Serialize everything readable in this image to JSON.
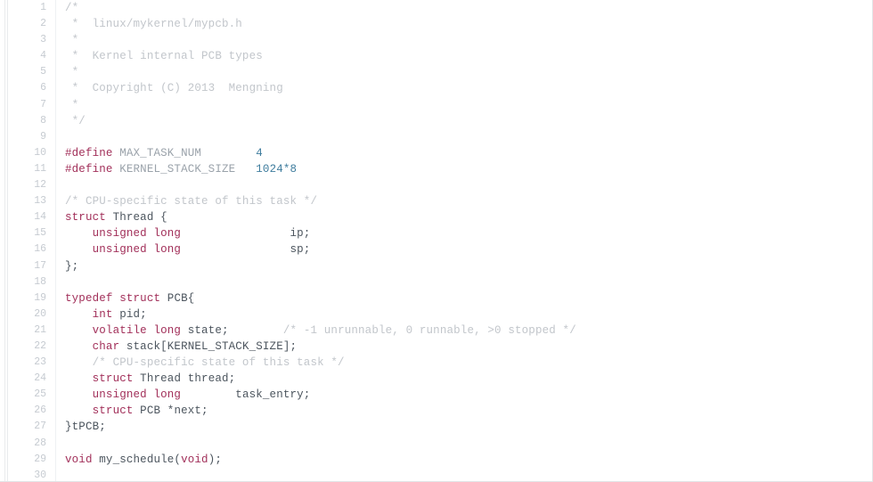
{
  "editor": {
    "title": "mypcb.h",
    "language": "C",
    "first_line": 1,
    "last_line": 30,
    "total_lines": 30,
    "colors": {
      "background": "#ffffff",
      "text": "#4c555e",
      "keyword": "#a2305a",
      "comment": "#c2c6cb",
      "number": "#3f7d9e",
      "macro_name": "#9aa2aa",
      "line_number": "#c6cbd1",
      "gutter_divider": "#eff1f3"
    }
  },
  "lines": [
    {
      "n": "1",
      "tokens": [
        {
          "t": "/*",
          "c": "comment"
        }
      ]
    },
    {
      "n": "2",
      "tokens": [
        {
          "t": " *  linux/mykernel/mypcb.h",
          "c": "comment"
        }
      ]
    },
    {
      "n": "3",
      "tokens": [
        {
          "t": " *",
          "c": "comment"
        }
      ]
    },
    {
      "n": "4",
      "tokens": [
        {
          "t": " *  Kernel internal PCB types",
          "c": "comment"
        }
      ]
    },
    {
      "n": "5",
      "tokens": [
        {
          "t": " *",
          "c": "comment"
        }
      ]
    },
    {
      "n": "6",
      "tokens": [
        {
          "t": " *  Copyright (C) 2013  Mengning",
          "c": "comment"
        }
      ]
    },
    {
      "n": "7",
      "tokens": [
        {
          "t": " *",
          "c": "comment"
        }
      ]
    },
    {
      "n": "8",
      "tokens": [
        {
          "t": " */",
          "c": "comment"
        }
      ]
    },
    {
      "n": "9",
      "tokens": [
        {
          "t": "",
          "c": "plain"
        }
      ]
    },
    {
      "n": "10",
      "tokens": [
        {
          "t": "#define",
          "c": "keyword"
        },
        {
          "t": " ",
          "c": "plain"
        },
        {
          "t": "MAX_TASK_NUM",
          "c": "macro"
        },
        {
          "t": "        ",
          "c": "plain"
        },
        {
          "t": "4",
          "c": "number"
        }
      ]
    },
    {
      "n": "11",
      "tokens": [
        {
          "t": "#define",
          "c": "keyword"
        },
        {
          "t": " ",
          "c": "plain"
        },
        {
          "t": "KERNEL_STACK_SIZE",
          "c": "macro"
        },
        {
          "t": "   ",
          "c": "plain"
        },
        {
          "t": "1024*8",
          "c": "number"
        }
      ]
    },
    {
      "n": "12",
      "tokens": [
        {
          "t": "",
          "c": "plain"
        }
      ]
    },
    {
      "n": "13",
      "tokens": [
        {
          "t": "/* CPU-specific state of this task */",
          "c": "comment"
        }
      ]
    },
    {
      "n": "14",
      "tokens": [
        {
          "t": "struct",
          "c": "keyword"
        },
        {
          "t": " Thread {",
          "c": "plain"
        }
      ]
    },
    {
      "n": "15",
      "tokens": [
        {
          "t": "    ",
          "c": "plain"
        },
        {
          "t": "unsigned long",
          "c": "keyword"
        },
        {
          "t": "                ",
          "c": "plain"
        },
        {
          "t": "ip;",
          "c": "plain"
        }
      ]
    },
    {
      "n": "16",
      "tokens": [
        {
          "t": "    ",
          "c": "plain"
        },
        {
          "t": "unsigned long",
          "c": "keyword"
        },
        {
          "t": "                ",
          "c": "plain"
        },
        {
          "t": "sp;",
          "c": "plain"
        }
      ]
    },
    {
      "n": "17",
      "tokens": [
        {
          "t": "};",
          "c": "plain"
        }
      ]
    },
    {
      "n": "18",
      "tokens": [
        {
          "t": "",
          "c": "plain"
        }
      ]
    },
    {
      "n": "19",
      "tokens": [
        {
          "t": "typedef",
          "c": "keyword"
        },
        {
          "t": " ",
          "c": "plain"
        },
        {
          "t": "struct",
          "c": "keyword"
        },
        {
          "t": " PCB{",
          "c": "plain"
        }
      ]
    },
    {
      "n": "20",
      "tokens": [
        {
          "t": "    ",
          "c": "plain"
        },
        {
          "t": "int",
          "c": "keyword"
        },
        {
          "t": " pid;",
          "c": "plain"
        }
      ]
    },
    {
      "n": "21",
      "tokens": [
        {
          "t": "    ",
          "c": "plain"
        },
        {
          "t": "volatile long",
          "c": "keyword"
        },
        {
          "t": " state;",
          "c": "plain"
        },
        {
          "t": "        ",
          "c": "plain"
        },
        {
          "t": "/* -1 unrunnable, 0 runnable, >0 stopped */",
          "c": "comment"
        }
      ]
    },
    {
      "n": "22",
      "tokens": [
        {
          "t": "    ",
          "c": "plain"
        },
        {
          "t": "char",
          "c": "keyword"
        },
        {
          "t": " stack[KERNEL_STACK_SIZE];",
          "c": "plain"
        }
      ]
    },
    {
      "n": "23",
      "tokens": [
        {
          "t": "    ",
          "c": "plain"
        },
        {
          "t": "/* CPU-specific state of this task */",
          "c": "comment"
        }
      ]
    },
    {
      "n": "24",
      "tokens": [
        {
          "t": "    ",
          "c": "plain"
        },
        {
          "t": "struct",
          "c": "keyword"
        },
        {
          "t": " Thread thread;",
          "c": "plain"
        }
      ]
    },
    {
      "n": "25",
      "tokens": [
        {
          "t": "    ",
          "c": "plain"
        },
        {
          "t": "unsigned long",
          "c": "keyword"
        },
        {
          "t": "        ",
          "c": "plain"
        },
        {
          "t": "task_entry;",
          "c": "plain"
        }
      ]
    },
    {
      "n": "26",
      "tokens": [
        {
          "t": "    ",
          "c": "plain"
        },
        {
          "t": "struct",
          "c": "keyword"
        },
        {
          "t": " PCB *next;",
          "c": "plain"
        }
      ]
    },
    {
      "n": "27",
      "tokens": [
        {
          "t": "}tPCB;",
          "c": "plain"
        }
      ]
    },
    {
      "n": "28",
      "tokens": [
        {
          "t": "",
          "c": "plain"
        }
      ]
    },
    {
      "n": "29",
      "tokens": [
        {
          "t": "void",
          "c": "keyword"
        },
        {
          "t": " my_schedule(",
          "c": "plain"
        },
        {
          "t": "void",
          "c": "keyword"
        },
        {
          "t": ");",
          "c": "plain"
        }
      ]
    },
    {
      "n": "30",
      "tokens": [
        {
          "t": "",
          "c": "plain"
        }
      ]
    }
  ]
}
